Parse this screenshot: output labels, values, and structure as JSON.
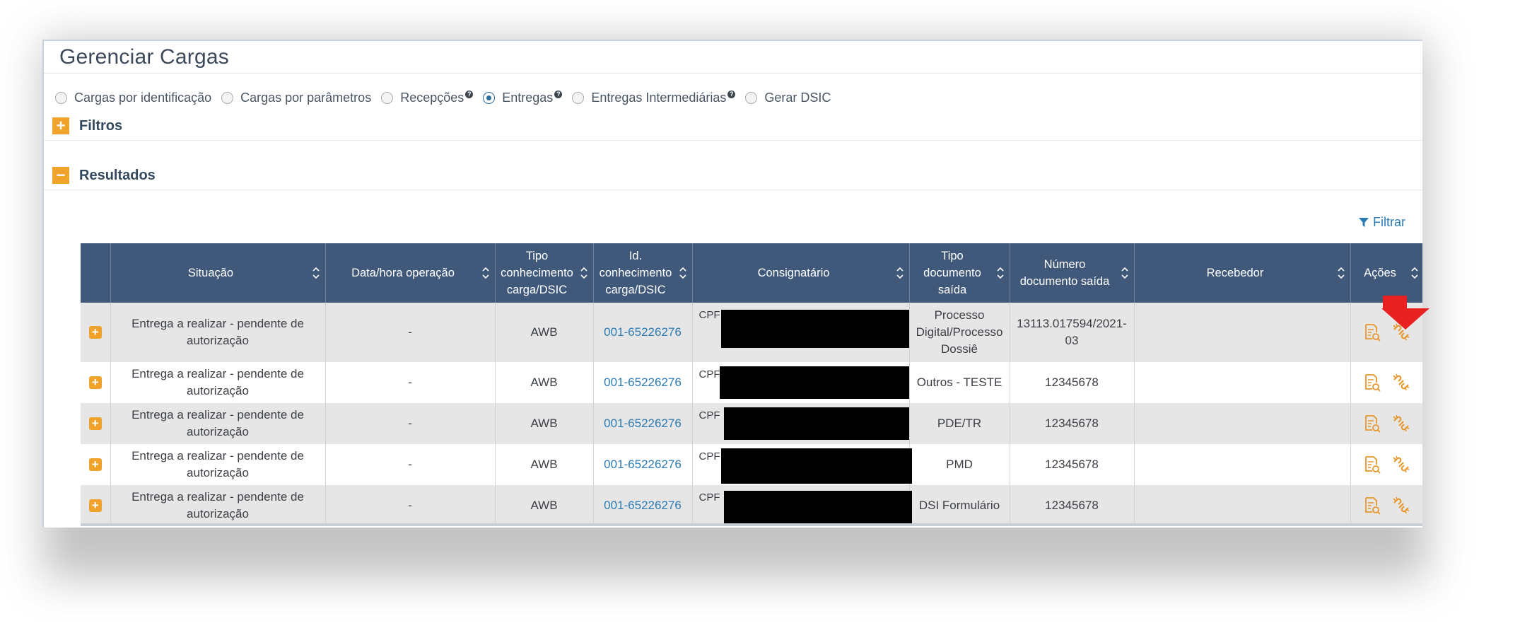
{
  "page": {
    "title": "Gerenciar Cargas"
  },
  "modes": [
    {
      "label": "Cargas por identificação",
      "checked": false,
      "help": false
    },
    {
      "label": "Cargas por parâmetros",
      "checked": false,
      "help": false
    },
    {
      "label": "Recepções",
      "checked": false,
      "help": true
    },
    {
      "label": "Entregas",
      "checked": true,
      "help": true
    },
    {
      "label": "Entregas Intermediárias",
      "checked": false,
      "help": true
    },
    {
      "label": "Gerar DSIC",
      "checked": false,
      "help": false
    }
  ],
  "sections": {
    "filters": "Filtros",
    "results": "Resultados",
    "filter_link": "Filtrar"
  },
  "table": {
    "columns": [
      "Situação",
      "Data/hora operação",
      "Tipo conhecimento carga/DSIC",
      "Id. conhecimento carga/DSIC",
      "Consignatário",
      "Tipo documento saída",
      "Número documento saída",
      "Recebedor",
      "Ações"
    ],
    "rows": [
      {
        "situacao": "Entrega a realizar - pendente de autorização",
        "data": "-",
        "tipo": "AWB",
        "id": "001-65226276",
        "consignatario": "CPF",
        "tipo_doc": "Processo Digital/Processo Dossiê",
        "numero": "13113.017594/2021-03",
        "recebedor": ""
      },
      {
        "situacao": "Entrega a realizar - pendente de autorização",
        "data": "-",
        "tipo": "AWB",
        "id": "001-65226276",
        "consignatario": "CPF",
        "tipo_doc": "Outros - TESTE",
        "numero": "12345678",
        "recebedor": ""
      },
      {
        "situacao": "Entrega a realizar - pendente de autorização",
        "data": "-",
        "tipo": "AWB",
        "id": "001-65226276",
        "consignatario": "CPF",
        "tipo_doc": "PDE/TR",
        "numero": "12345678",
        "recebedor": ""
      },
      {
        "situacao": "Entrega a realizar - pendente de autorização",
        "data": "-",
        "tipo": "AWB",
        "id": "001-65226276",
        "consignatario": "CPF",
        "tipo_doc": "PMD",
        "numero": "12345678",
        "recebedor": ""
      },
      {
        "situacao": "Entrega a realizar - pendente de autorização",
        "data": "-",
        "tipo": "AWB",
        "id": "001-65226276",
        "consignatario": "CPF",
        "tipo_doc": "DSI Formulário",
        "numero": "12345678",
        "recebedor": ""
      }
    ]
  },
  "colors": {
    "header_bg": "#40597a",
    "accent_orange": "#f1a22b",
    "link_blue": "#2b7bb5",
    "arrow_red": "#e8201f"
  }
}
